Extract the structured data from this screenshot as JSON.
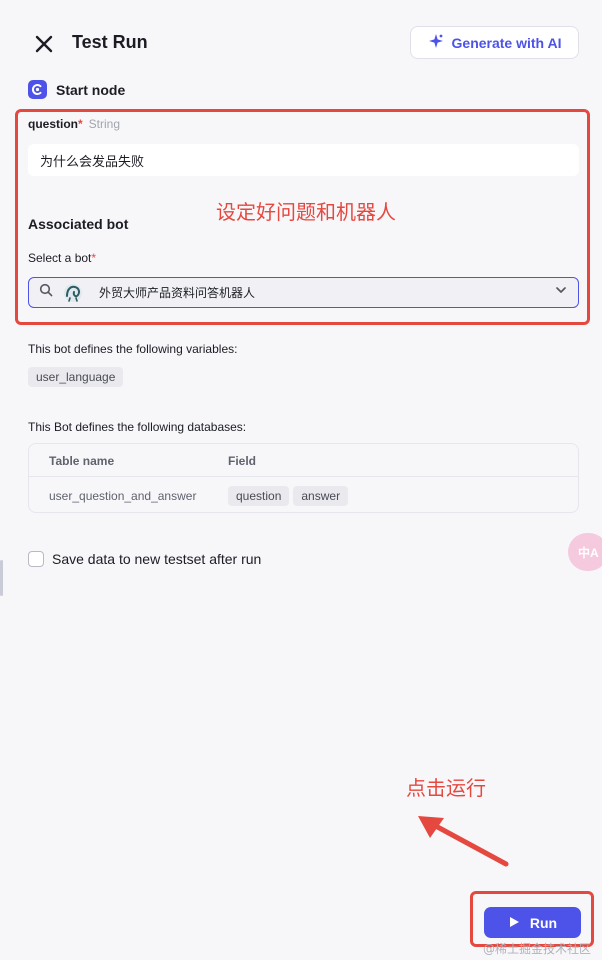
{
  "header": {
    "title": "Test Run",
    "generate_label": "Generate with AI"
  },
  "start_node": {
    "label": "Start node"
  },
  "question": {
    "label": "question",
    "required_mark": "*",
    "type": "String",
    "value": "为什么会发品失败"
  },
  "annotations": {
    "setup_text": "设定好问题和机器人",
    "run_text": "点击运行"
  },
  "bot": {
    "section_title": "Associated bot",
    "select_label": "Select a bot",
    "required_mark": "*",
    "selected": "外贸大师产品资料问答机器人"
  },
  "variables": {
    "label": "This bot defines the following variables:",
    "items": [
      "user_language"
    ]
  },
  "databases": {
    "label": "This Bot defines the following databases:",
    "columns": [
      "Table name",
      "Field"
    ],
    "rows": [
      {
        "table": "user_question_and_answer",
        "fields": [
          "question",
          "answer"
        ]
      }
    ]
  },
  "testset": {
    "label": "Save data to new testset after run"
  },
  "translate": {
    "label": "中A"
  },
  "run": {
    "label": "Run"
  },
  "watermark": "@稀土掘金技术社区",
  "colors": {
    "accent": "#4d53e8",
    "annotation": "#e5483f"
  }
}
